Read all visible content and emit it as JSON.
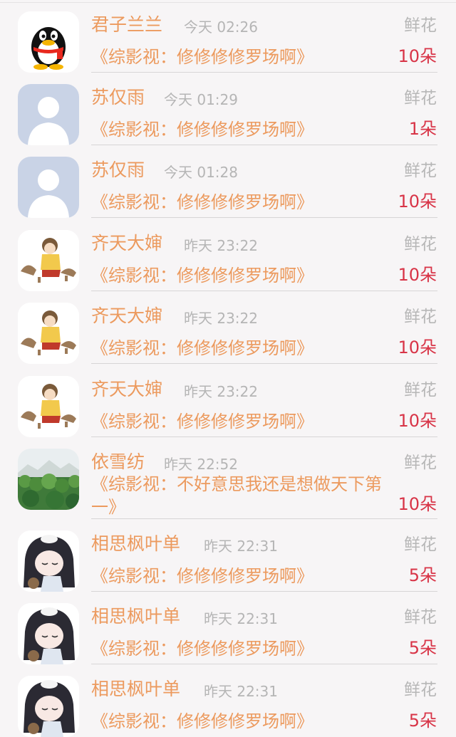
{
  "items": [
    {
      "name": "君子兰兰",
      "time": "今天 02:26",
      "gift": "鲜花",
      "title": "《综影视：修修修修罗场啊》",
      "count": "10朵",
      "avatar": "qq-penguin-avatar"
    },
    {
      "name": "苏仅雨",
      "time": "今天 01:29",
      "gift": "鲜花",
      "title": "《综影视：修修修修罗场啊》",
      "count": "1朵",
      "avatar": "default-user-avatar"
    },
    {
      "name": "苏仅雨",
      "time": "今天 01:28",
      "gift": "鲜花",
      "title": "《综影视：修修修修罗场啊》",
      "count": "10朵",
      "avatar": "default-user-avatar"
    },
    {
      "name": "齐天大婶",
      "time": "昨天 23:22",
      "gift": "鲜花",
      "title": "《综影视：修修修修罗场啊》",
      "count": "10朵",
      "avatar": "anime-girl-with-deer-avatar"
    },
    {
      "name": "齐天大婶",
      "time": "昨天 23:22",
      "gift": "鲜花",
      "title": "《综影视：修修修修罗场啊》",
      "count": "10朵",
      "avatar": "anime-girl-with-deer-avatar"
    },
    {
      "name": "齐天大婶",
      "time": "昨天 23:22",
      "gift": "鲜花",
      "title": "《综影视：修修修修罗场啊》",
      "count": "10朵",
      "avatar": "anime-girl-with-deer-avatar"
    },
    {
      "name": "依雪纺",
      "time": "昨天 22:52",
      "gift": "鲜花",
      "title": "《综影视：不好意思我还是想做天下第一》",
      "count": "10朵",
      "avatar": "forest-landscape-avatar"
    },
    {
      "name": "相思枫叶单",
      "time": "昨天 22:31",
      "gift": "鲜花",
      "title": "《综影视：修修修修罗场啊》",
      "count": "5朵",
      "avatar": "anime-sleeping-girl-avatar"
    },
    {
      "name": "相思枫叶单",
      "time": "昨天 22:31",
      "gift": "鲜花",
      "title": "《综影视：修修修修罗场啊》",
      "count": "5朵",
      "avatar": "anime-sleeping-girl-avatar"
    },
    {
      "name": "相思枫叶单",
      "time": "昨天 22:31",
      "gift": "鲜花",
      "title": "《综影视：修修修修罗场啊》",
      "count": "5朵",
      "avatar": "anime-sleeping-girl-avatar"
    }
  ],
  "colors": {
    "name": "#ec9a5e",
    "title": "#ec9a5e",
    "time": "#b5b5b5",
    "gift": "#b7b7b7",
    "count": "#d83447",
    "background": "#f7f5f6",
    "separator": "#d7d5d6"
  }
}
